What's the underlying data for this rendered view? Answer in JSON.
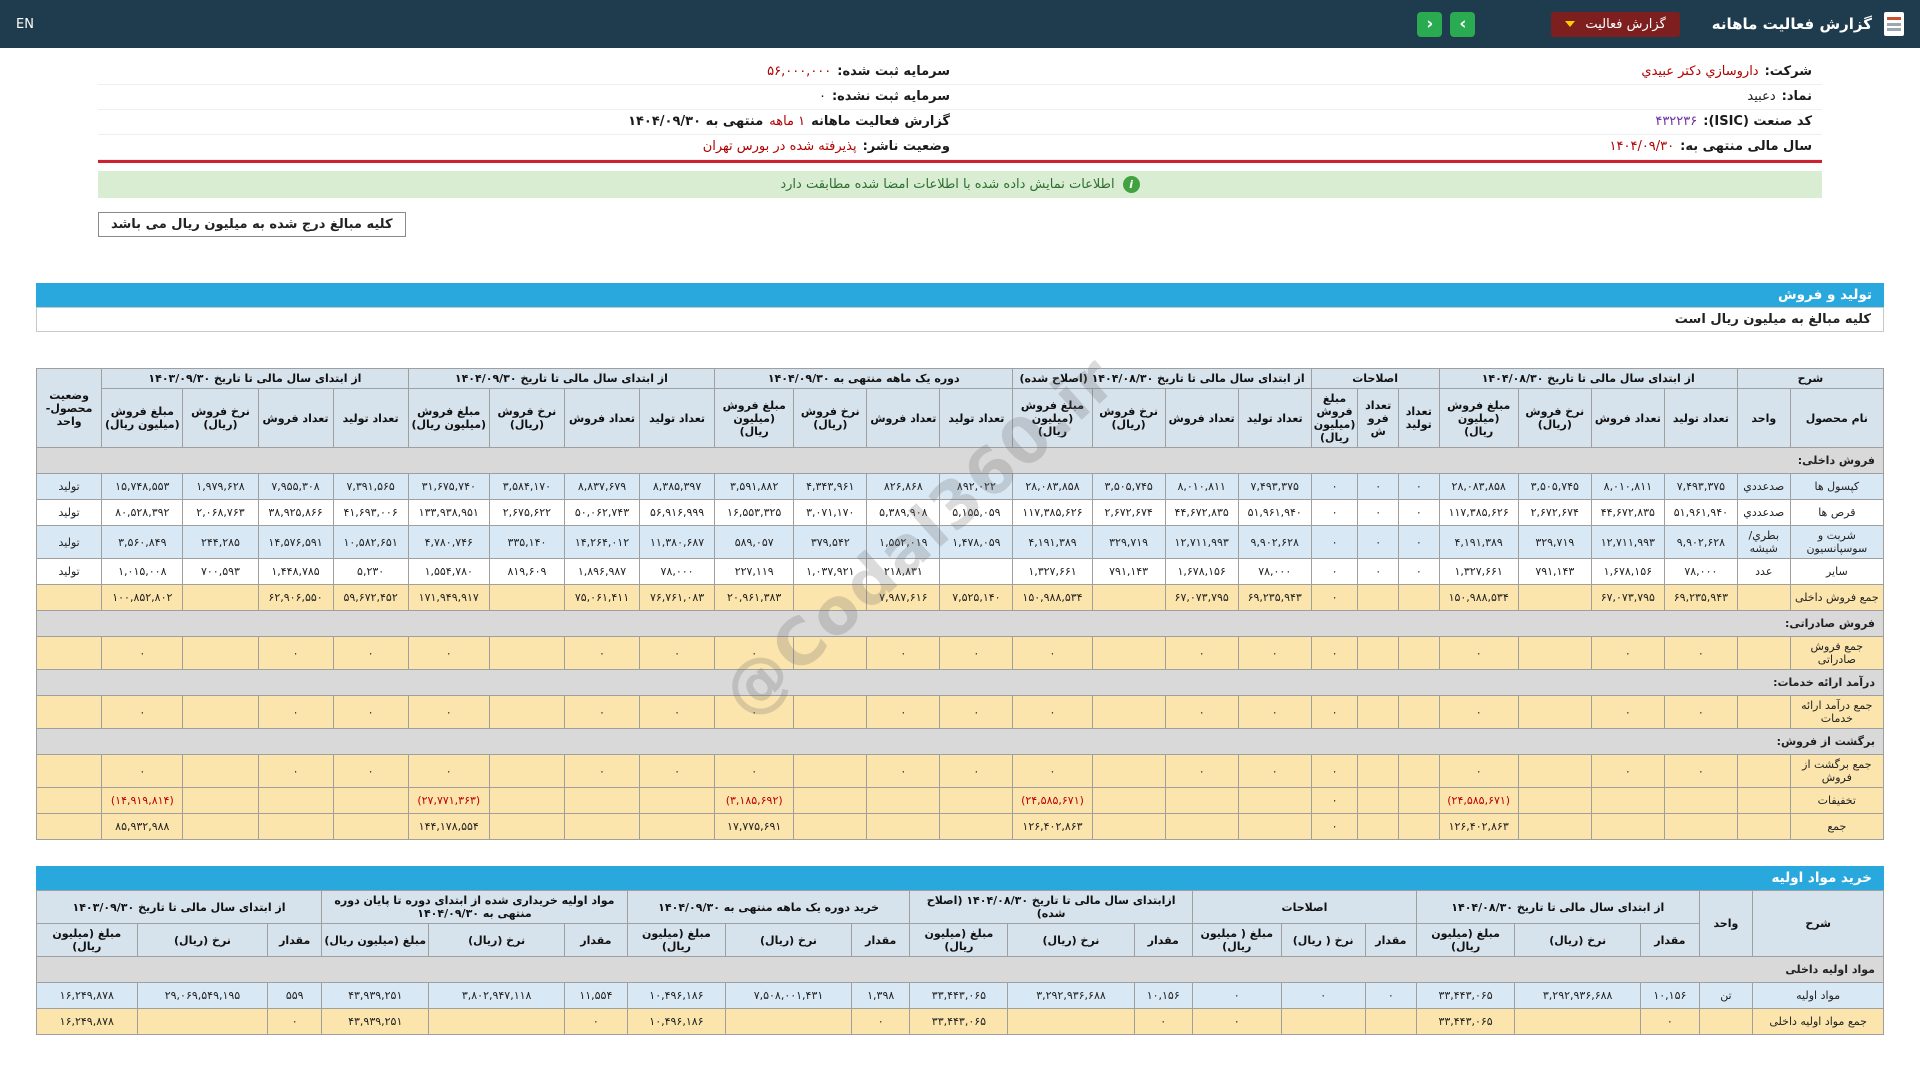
{
  "theme": {
    "topbar_bg": "#1e3c4e",
    "accent_blue": "#29a8de",
    "highlight_yellow": "#fbe5ad",
    "zebra_blue": "#d9e8f5",
    "section_gray": "#d9d9d9",
    "negative_red": "#c00000",
    "notice_green_bg": "#d9edd3",
    "dropdown_maroon": "#7e1f1f",
    "button_green": "#2aab52",
    "divider_red": "#cf2030"
  },
  "topbar": {
    "en_label": "EN",
    "title": "گزارش فعالیت ماهانه",
    "report_dropdown_label": "گزارش فعالیت",
    "next_label": "›",
    "prev_label": "‹"
  },
  "info": {
    "right_rows": [
      {
        "label": "شرکت:",
        "value": "داروسازي دکتر عبيدي",
        "style": "red"
      },
      {
        "label": "نماد:",
        "value": "دعبيد",
        "style": "dark"
      },
      {
        "label": "کد صنعت (ISIC):",
        "value": "۴۳۲۲۳۶",
        "style": "purple"
      },
      {
        "label": "سال مالی منتهی به:",
        "value": "۱۴۰۴/۰۹/۳۰",
        "style": "red"
      }
    ],
    "left_rows": [
      {
        "label": "سرمایه ثبت شده:",
        "value": "۵۶,۰۰۰,۰۰۰",
        "style": "red"
      },
      {
        "label": "سرمایه ثبت نشده:",
        "value": "۰",
        "style": "dark"
      },
      {
        "label": "گزارش فعالیت ماهانه",
        "value": "۱ ماهه",
        "suffix": "منتهی به ۱۴۰۴/۰۹/۳۰",
        "style": "red"
      },
      {
        "label": "وضعیت ناشر:",
        "value": "پذیرفته شده در بورس تهران",
        "style": "red"
      }
    ]
  },
  "notice": {
    "text": "اطلاعات نمایش داده شده با اطلاعات امضا شده مطابقت دارد"
  },
  "amounts_box": "کلیه مبالغ درج شده به میلیون ریال می باشد",
  "watermark": "@Codal360.ir",
  "production": {
    "section_title": "تولید و فروش",
    "units_note": "کلیه مبالغ به میلیون ریال است",
    "header": {
      "desc": "شرح",
      "product": "نام محصول",
      "unit": "واحد",
      "status": "وضعیت محصول- واحد",
      "groups": [
        {
          "label": "از ابتدای سال مالی تا تاریخ ۱۴۰۴/۰۸/۳۰",
          "cols": [
            "تعداد تولید",
            "تعداد فروش",
            "نرخ فروش (ریال)",
            "مبلغ فروش (میلیون ریال)"
          ]
        },
        {
          "label": "اصلاحات",
          "cols": [
            "تعداد تولید",
            "تعداد فروش",
            "مبلغ فروش (میلیون ریال)"
          ]
        },
        {
          "label": "از ابتدای سال مالی تا تاریخ ۱۴۰۴/۰۸/۳۰ (اصلاح شده)",
          "cols": [
            "تعداد تولید",
            "تعداد فروش",
            "نرخ فروش (ریال)",
            "مبلغ فروش (میلیون ریال)"
          ]
        },
        {
          "label": "دوره یک ماهه منتهی به ۱۴۰۴/۰۹/۳۰",
          "cols": [
            "تعداد تولید",
            "تعداد فروش",
            "نرخ فروش (ریال)",
            "مبلغ فروش (میلیون ریال)"
          ]
        },
        {
          "label": "از ابتدای سال مالی تا تاریخ ۱۴۰۴/۰۹/۳۰",
          "cols": [
            "تعداد تولید",
            "تعداد فروش",
            "نرخ فروش (ریال)",
            "مبلغ فروش (میلیون ریال)"
          ]
        },
        {
          "label": "از ابتدای سال مالی تا تاریخ ۱۴۰۳/۰۹/۳۰",
          "cols": [
            "تعداد تولید",
            "تعداد فروش",
            "نرخ فروش (ریال)",
            "مبلغ فروش (میلیون ریال)"
          ]
        }
      ]
    },
    "rows": [
      {
        "type": "section",
        "label": "فروش داخلی:"
      },
      {
        "type": "data",
        "shade": true,
        "label": "کپسول ها",
        "unit": "صدعددي",
        "status": "تولید",
        "cells": [
          "۷,۴۹۳,۳۷۵",
          "۸,۰۱۰,۸۱۱",
          "۳,۵۰۵,۷۴۵",
          "۲۸,۰۸۳,۸۵۸",
          "۰",
          "۰",
          "۰",
          "۷,۴۹۳,۳۷۵",
          "۸,۰۱۰,۸۱۱",
          "۳,۵۰۵,۷۴۵",
          "۲۸,۰۸۳,۸۵۸",
          "۸۹۲,۰۲۲",
          "۸۲۶,۸۶۸",
          "۴,۳۴۳,۹۶۱",
          "۳,۵۹۱,۸۸۲",
          "۸,۳۸۵,۳۹۷",
          "۸,۸۳۷,۶۷۹",
          "۳,۵۸۴,۱۷۰",
          "۳۱,۶۷۵,۷۴۰",
          "۷,۳۹۱,۵۶۵",
          "۷,۹۵۵,۳۰۸",
          "۱,۹۷۹,۶۲۸",
          "۱۵,۷۴۸,۵۵۳"
        ]
      },
      {
        "type": "data",
        "shade": false,
        "label": "قرص ها",
        "unit": "صدعددي",
        "status": "تولید",
        "cells": [
          "۵۱,۹۶۱,۹۴۰",
          "۴۴,۶۷۲,۸۳۵",
          "۲,۶۷۲,۶۷۴",
          "۱۱۷,۳۸۵,۶۲۶",
          "۰",
          "۰",
          "۰",
          "۵۱,۹۶۱,۹۴۰",
          "۴۴,۶۷۲,۸۳۵",
          "۲,۶۷۲,۶۷۴",
          "۱۱۷,۳۸۵,۶۲۶",
          "۵,۱۵۵,۰۵۹",
          "۵,۳۸۹,۹۰۸",
          "۳,۰۷۱,۱۷۰",
          "۱۶,۵۵۳,۳۲۵",
          "۵۶,۹۱۶,۹۹۹",
          "۵۰,۰۶۲,۷۴۳",
          "۲,۶۷۵,۶۲۲",
          "۱۳۳,۹۳۸,۹۵۱",
          "۴۱,۶۹۳,۰۰۶",
          "۳۸,۹۲۵,۸۶۶",
          "۲,۰۶۸,۷۶۳",
          "۸۰,۵۲۸,۳۹۲"
        ]
      },
      {
        "type": "data",
        "shade": true,
        "label": "شربت و سوسپانسیون",
        "unit": "بطري/ شیشه",
        "status": "تولید",
        "cells": [
          "۹,۹۰۲,۶۲۸",
          "۱۲,۷۱۱,۹۹۳",
          "۳۲۹,۷۱۹",
          "۴,۱۹۱,۳۸۹",
          "۰",
          "۰",
          "۰",
          "۹,۹۰۲,۶۲۸",
          "۱۲,۷۱۱,۹۹۳",
          "۳۲۹,۷۱۹",
          "۴,۱۹۱,۳۸۹",
          "۱,۴۷۸,۰۵۹",
          "۱,۵۵۲,۰۱۹",
          "۳۷۹,۵۴۲",
          "۵۸۹,۰۵۷",
          "۱۱,۳۸۰,۶۸۷",
          "۱۴,۲۶۴,۰۱۲",
          "۳۳۵,۱۴۰",
          "۴,۷۸۰,۷۴۶",
          "۱۰,۵۸۲,۶۵۱",
          "۱۴,۵۷۶,۵۹۱",
          "۲۴۴,۲۸۵",
          "۳,۵۶۰,۸۴۹"
        ]
      },
      {
        "type": "data",
        "shade": false,
        "label": "سایر",
        "unit": "عدد",
        "status": "تولید",
        "cells": [
          "۷۸,۰۰۰",
          "۱,۶۷۸,۱۵۶",
          "۷۹۱,۱۴۳",
          "۱,۳۲۷,۶۶۱",
          "۰",
          "۰",
          "۰",
          "۷۸,۰۰۰",
          "۱,۶۷۸,۱۵۶",
          "۷۹۱,۱۴۳",
          "۱,۳۲۷,۶۶۱",
          "",
          "۲۱۸,۸۳۱",
          "۱,۰۳۷,۹۲۱",
          "۲۲۷,۱۱۹",
          "۷۸,۰۰۰",
          "۱,۸۹۶,۹۸۷",
          "۸۱۹,۶۰۹",
          "۱,۵۵۴,۷۸۰",
          "۵,۲۳۰",
          "۱,۴۴۸,۷۸۵",
          "۷۰۰,۵۹۳",
          "۱,۰۱۵,۰۰۸"
        ]
      },
      {
        "type": "total",
        "label": "جمع فروش داخلی",
        "cells": [
          "۶۹,۲۳۵,۹۴۳",
          "۶۷,۰۷۳,۷۹۵",
          "",
          "۱۵۰,۹۸۸,۵۳۴",
          "",
          "",
          "۰",
          "۶۹,۲۳۵,۹۴۳",
          "۶۷,۰۷۳,۷۹۵",
          "",
          "۱۵۰,۹۸۸,۵۳۴",
          "۷,۵۲۵,۱۴۰",
          "۷,۹۸۷,۶۱۶",
          "",
          "۲۰,۹۶۱,۳۸۳",
          "۷۶,۷۶۱,۰۸۳",
          "۷۵,۰۶۱,۴۱۱",
          "",
          "۱۷۱,۹۴۹,۹۱۷",
          "۵۹,۶۷۲,۴۵۲",
          "۶۲,۹۰۶,۵۵۰",
          "",
          "۱۰۰,۸۵۲,۸۰۲"
        ]
      },
      {
        "type": "section",
        "label": "فروش صادراتی:"
      },
      {
        "type": "total",
        "label": "جمع فروش صادراتی",
        "cells": [
          "۰",
          "۰",
          "",
          "۰",
          "",
          "",
          "۰",
          "۰",
          "۰",
          "",
          "۰",
          "۰",
          "۰",
          "",
          "۰",
          "۰",
          "۰",
          "",
          "۰",
          "۰",
          "۰",
          "",
          "۰"
        ]
      },
      {
        "type": "section",
        "label": "درآمد ارائه خدمات:"
      },
      {
        "type": "total",
        "label": "جمع درآمد ارائه خدمات",
        "cells": [
          "۰",
          "۰",
          "",
          "۰",
          "",
          "",
          "۰",
          "۰",
          "۰",
          "",
          "۰",
          "۰",
          "۰",
          "",
          "۰",
          "۰",
          "۰",
          "",
          "۰",
          "۰",
          "۰",
          "",
          "۰"
        ]
      },
      {
        "type": "section",
        "label": "برگشت از فروش:"
      },
      {
        "type": "total",
        "label": "جمع برگشت از فروش",
        "cells": [
          "۰",
          "۰",
          "",
          "۰",
          "",
          "",
          "۰",
          "۰",
          "۰",
          "",
          "۰",
          "۰",
          "۰",
          "",
          "۰",
          "۰",
          "۰",
          "",
          "۰",
          "۰",
          "۰",
          "",
          "۰"
        ]
      },
      {
        "type": "discount",
        "label": "تخفیفات",
        "cells": [
          "",
          "",
          "",
          "(۲۴,۵۸۵,۶۷۱)",
          "",
          "",
          "۰",
          "",
          "",
          "",
          "(۲۴,۵۸۵,۶۷۱)",
          "",
          "",
          "",
          "(۳,۱۸۵,۶۹۲)",
          "",
          "",
          "",
          "(۲۷,۷۷۱,۳۶۳)",
          "",
          "",
          "",
          "(۱۴,۹۱۹,۸۱۴)"
        ]
      },
      {
        "type": "total",
        "label": "جمع",
        "cells": [
          "",
          "",
          "",
          "۱۲۶,۴۰۲,۸۶۳",
          "",
          "",
          "۰",
          "",
          "",
          "",
          "۱۲۶,۴۰۲,۸۶۳",
          "",
          "",
          "",
          "۱۷,۷۷۵,۶۹۱",
          "",
          "",
          "",
          "۱۴۴,۱۷۸,۵۵۴",
          "",
          "",
          "",
          "۸۵,۹۳۲,۹۸۸"
        ]
      }
    ]
  },
  "materials": {
    "section_title": "خرید مواد اولیه",
    "header": {
      "desc": "شرح",
      "unit": "واحد",
      "groups": [
        {
          "label": "از ابتدای سال مالی تا تاریخ ۱۴۰۴/۰۸/۳۰",
          "cols": [
            "مقدار",
            "نرخ (ریال)",
            "مبلغ (میلیون ریال)"
          ]
        },
        {
          "label": "اصلاحات",
          "cols": [
            "مقدار",
            "نرخ ( ریال)",
            "مبلغ ( میلیون ریال)"
          ]
        },
        {
          "label": "ازابتدای سال مالی تا تاریخ ۱۴۰۴/۰۸/۳۰ (اصلاح شده)",
          "cols": [
            "مقدار",
            "نرخ (ریال)",
            "مبلغ (میلیون ریال)"
          ]
        },
        {
          "label": "خرید دوره یک ماهه منتهی به ۱۴۰۴/۰۹/۳۰",
          "cols": [
            "مقدار",
            "نرخ (ریال)",
            "مبلغ (میلیون ریال)"
          ]
        },
        {
          "label": "مواد اولیه خریداری شده از ابتدای دوره تا پایان دوره منتهی به ۱۴۰۴/۰۹/۳۰",
          "cols": [
            "مقدار",
            "نرخ (ریال)",
            "مبلغ (میلیون ریال)"
          ]
        },
        {
          "label": "از ابتدای سال مالی تا تاریخ ۱۴۰۳/۰۹/۳۰",
          "cols": [
            "مقدار",
            "نرخ (ریال)",
            "مبلغ (میلیون ریال)"
          ]
        }
      ]
    },
    "rows": [
      {
        "type": "section",
        "label": "مواد اولیه داخلی"
      },
      {
        "type": "data",
        "shade": true,
        "label": "مواد اولیه",
        "unit": "تن",
        "cells": [
          "۱۰,۱۵۶",
          "۳,۲۹۲,۹۳۶,۶۸۸",
          "۳۳,۴۴۳,۰۶۵",
          "۰",
          "۰",
          "۰",
          "۱۰,۱۵۶",
          "۳,۲۹۲,۹۳۶,۶۸۸",
          "۳۳,۴۴۳,۰۶۵",
          "۱,۳۹۸",
          "۷,۵۰۸,۰۰۱,۴۳۱",
          "۱۰,۴۹۶,۱۸۶",
          "۱۱,۵۵۴",
          "۳,۸۰۲,۹۴۷,۱۱۸",
          "۴۳,۹۳۹,۲۵۱",
          "۵۵۹",
          "۲۹,۰۶۹,۵۴۹,۱۹۵",
          "۱۶,۲۴۹,۸۷۸"
        ]
      },
      {
        "type": "total",
        "label": "جمع مواد اولیه داخلی",
        "cells": [
          "۰",
          "",
          "۳۳,۴۴۳,۰۶۵",
          "",
          "",
          "۰",
          "۰",
          "",
          "۳۳,۴۴۳,۰۶۵",
          "۰",
          "",
          "۱۰,۴۹۶,۱۸۶",
          "۰",
          "",
          "۴۳,۹۳۹,۲۵۱",
          "۰",
          "",
          "۱۶,۲۴۹,۸۷۸"
        ]
      }
    ]
  }
}
